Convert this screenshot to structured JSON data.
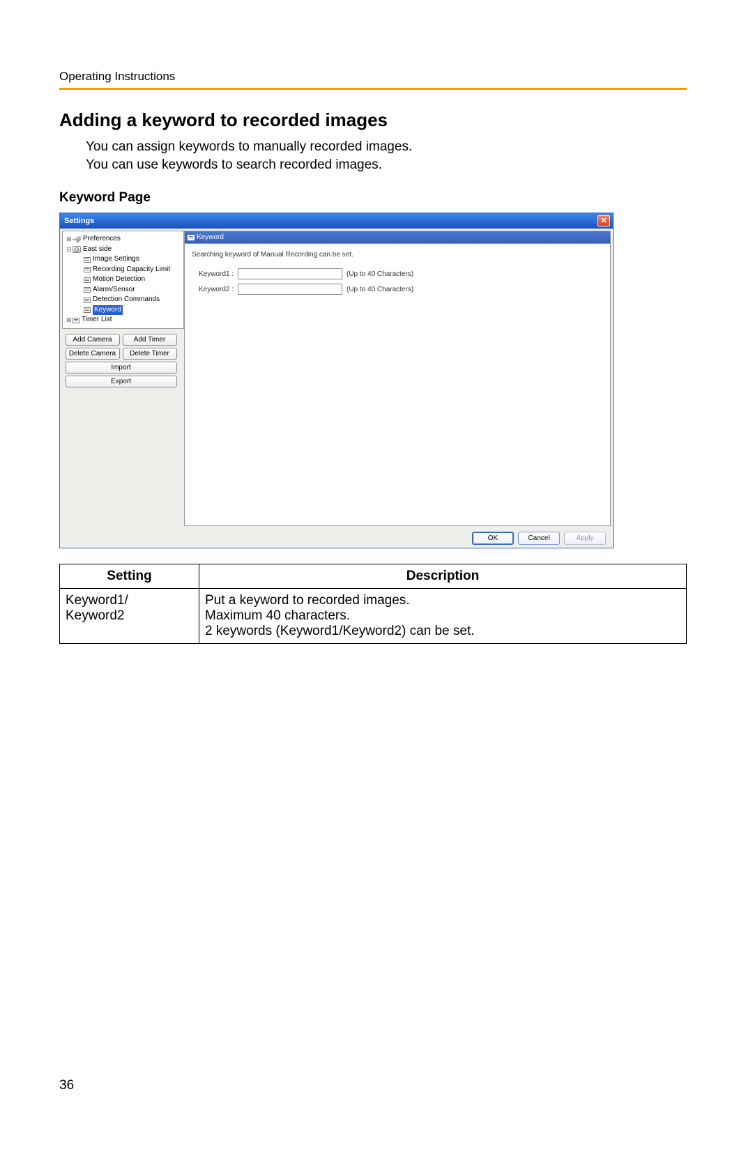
{
  "header": "Operating Instructions",
  "title": "Adding a keyword to recorded images",
  "intro_line1": "You can assign keywords to manually recorded images.",
  "intro_line2": "You can use keywords to search recorded images.",
  "subtitle": "Keyword Page",
  "page_number": "36",
  "window": {
    "title": "Settings",
    "tree": {
      "preferences": "Preferences",
      "eastside": "East side",
      "image_settings": "Image Settings",
      "recording_capacity": "Recording Capacity Limit",
      "motion_detection": "Motion Detection",
      "alarm_sensor": "Alarm/Sensor",
      "detection_commands": "Detection Commands",
      "keyword": "Keyword",
      "timer_list": "Timer List"
    },
    "side_buttons": {
      "add_camera": "Add Camera",
      "add_timer": "Add Timer",
      "delete_camera": "Delete Camera",
      "delete_timer": "Delete Timer",
      "import": "Import",
      "export": "Export"
    },
    "panel": {
      "header": "Keyword",
      "desc": "Searching keyword of Manual Recording can be set.",
      "keyword1_label": "Keyword1 :",
      "keyword2_label": "Keyword2 :",
      "keyword1_value": "",
      "keyword2_value": "",
      "hint": "(Up to 40 Characters)"
    },
    "footer": {
      "ok": "OK",
      "cancel": "Cancel",
      "apply": "Apply"
    }
  },
  "table": {
    "header_setting": "Setting",
    "header_description": "Description",
    "row1_setting_line1": "Keyword1/",
    "row1_setting_line2": "Keyword2",
    "row1_desc_line1": "Put a keyword to recorded images.",
    "row1_desc_line2": "Maximum 40 characters.",
    "row1_desc_line3": "2 keywords (Keyword1/Keyword2) can be set."
  }
}
